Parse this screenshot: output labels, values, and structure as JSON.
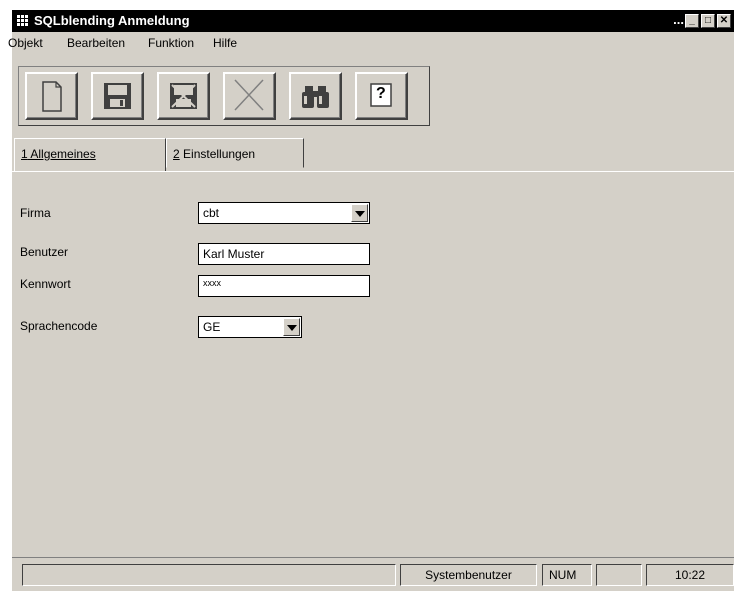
{
  "window": {
    "title": "SQLblending Anmeldung",
    "title_dots": "...",
    "controls": {
      "minimize": "_",
      "maximize": "□",
      "close": "✕"
    }
  },
  "menu": [
    "Objekt",
    "Bearbeiten",
    "Funktion",
    "Hilfe"
  ],
  "toolbar": [
    {
      "name": "new-document-button",
      "icon": "new-document-icon"
    },
    {
      "name": "save-button",
      "icon": "floppy-disk-icon"
    },
    {
      "name": "save-close-button",
      "icon": "save-delete-icon"
    },
    {
      "name": "delete-button",
      "icon": "x-icon"
    },
    {
      "name": "search-button",
      "icon": "binoculars-icon"
    },
    {
      "name": "help-button",
      "icon": "question-icon",
      "label": "?"
    }
  ],
  "tabs": [
    {
      "hotkey": "1",
      "label": " Allgemeines",
      "active": true
    },
    {
      "hotkey": "2",
      "label": " Einstellungen",
      "active": false
    }
  ],
  "form": {
    "firma": {
      "label": "Firma",
      "value": "cbt"
    },
    "benutzer": {
      "label": "Benutzer",
      "value": "Karl Muster"
    },
    "kennwort": {
      "label": "Kennwort",
      "value": "xxxx"
    },
    "sprachencode": {
      "label": "Sprachencode",
      "value": "GE"
    }
  },
  "status": {
    "message": "",
    "user": "Systembenutzer",
    "num": "NUM",
    "extra": "",
    "time": "10:22"
  },
  "colors": {
    "face": "#d4d0c8",
    "title_bg": "#000000",
    "title_fg": "#ffffff"
  }
}
